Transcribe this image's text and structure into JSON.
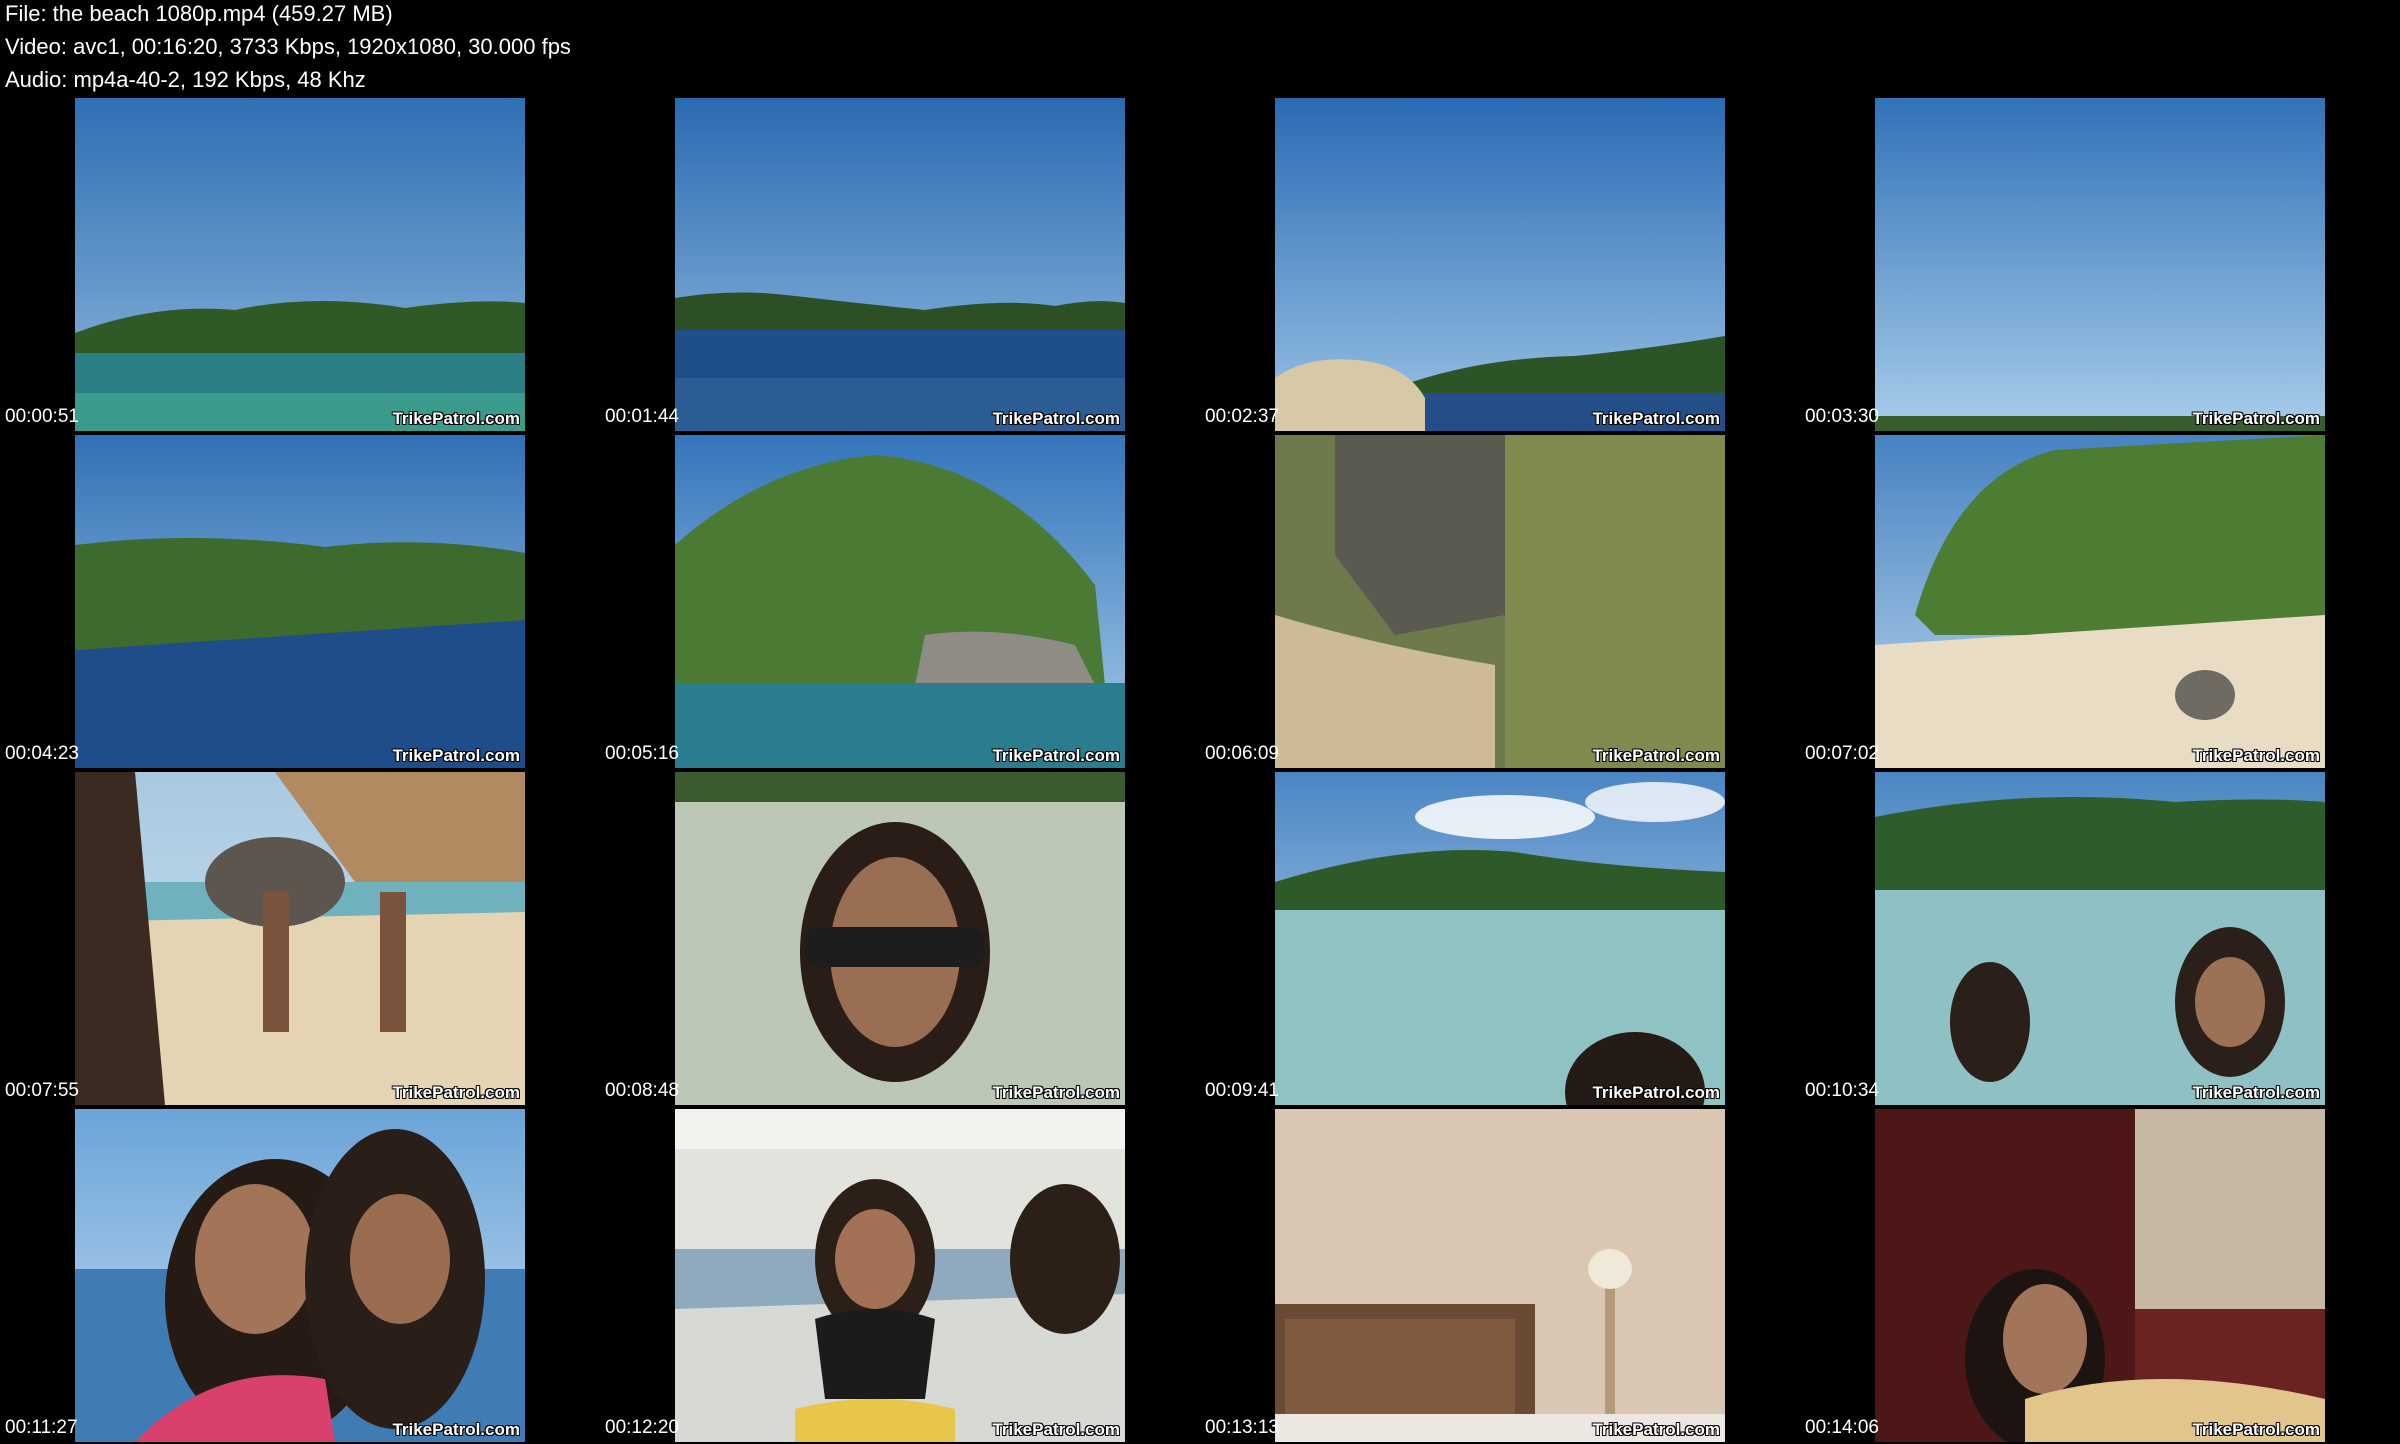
{
  "info": {
    "file_line": "File: the beach 1080p.mp4 (459.27 MB)",
    "video_line": "Video: avc1, 00:16:20, 3733 Kbps, 1920x1080, 30.000 fps",
    "audio_line": "Audio: mp4a-40-2, 192 Kbps, 48 Khz"
  },
  "watermark": "TrikePatrol.com",
  "thumbnails": [
    {
      "time": "00:00:51",
      "scene": "open-sea-island"
    },
    {
      "time": "00:01:44",
      "scene": "open-sea-far-island"
    },
    {
      "time": "00:02:37",
      "scene": "sea-rock-foreground"
    },
    {
      "time": "00:03:30",
      "scene": "sky-only"
    },
    {
      "time": "00:04:23",
      "scene": "sea-green-shore"
    },
    {
      "time": "00:05:16",
      "scene": "rocky-island"
    },
    {
      "time": "00:06:09",
      "scene": "cliff-closeup"
    },
    {
      "time": "00:07:02",
      "scene": "beach-cliff"
    },
    {
      "time": "00:07:55",
      "scene": "beach-walkers"
    },
    {
      "time": "00:08:48",
      "scene": "shallow-water-portrait"
    },
    {
      "time": "00:09:41",
      "scene": "lagoon-clouds"
    },
    {
      "time": "00:10:34",
      "scene": "lagoon-swimmers"
    },
    {
      "time": "00:11:27",
      "scene": "boat-selfie"
    },
    {
      "time": "00:12:20",
      "scene": "boat-deck"
    },
    {
      "time": "00:13:13",
      "scene": "hotel-room"
    },
    {
      "time": "00:14:06",
      "scene": "red-room"
    }
  ]
}
